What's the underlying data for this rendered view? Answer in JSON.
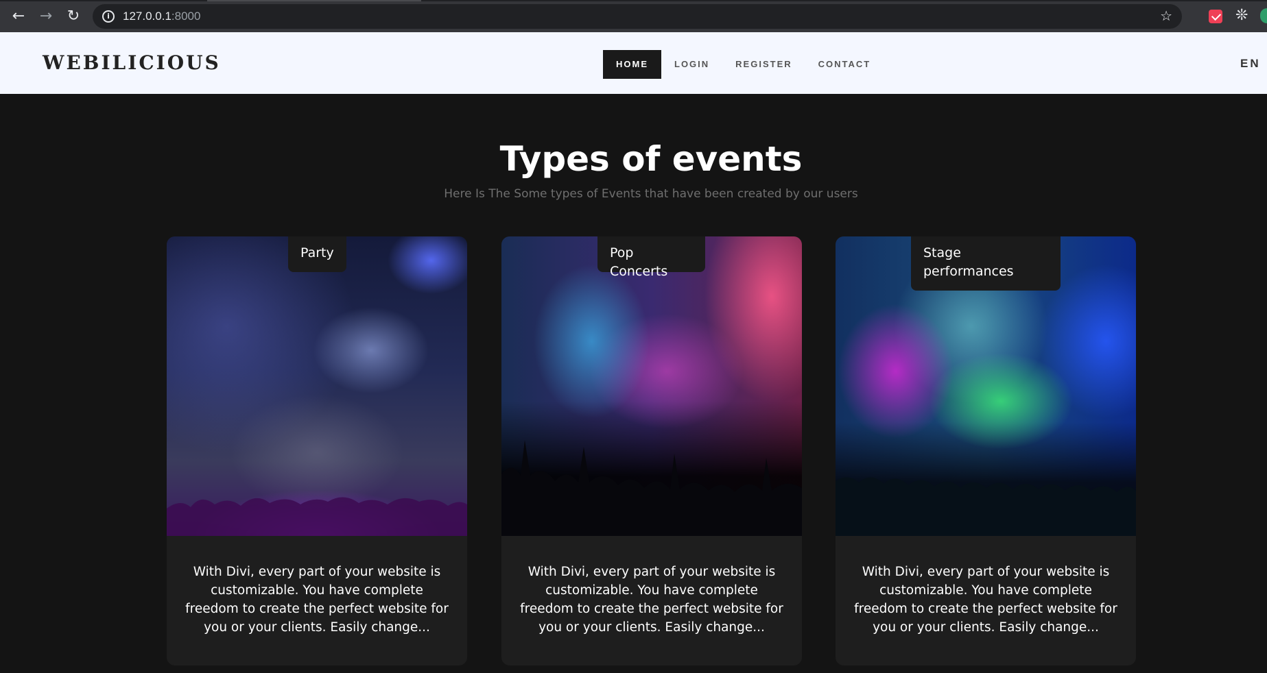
{
  "browser": {
    "url_host": "127.0.0.1",
    "url_port": ":8000",
    "icons": {
      "back": "arrow-left-icon",
      "forward": "arrow-right-icon",
      "reload": "reload-icon",
      "info": "info-icon",
      "bookmark": "star-icon",
      "extension_pocket": "pocket-icon",
      "extensions": "puzzle-icon"
    }
  },
  "header": {
    "logo": "WEBILICIOUS",
    "nav": [
      {
        "label": "HOME",
        "active": true
      },
      {
        "label": "LOGIN",
        "active": false
      },
      {
        "label": "REGISTER",
        "active": false
      },
      {
        "label": "CONTACT",
        "active": false
      }
    ],
    "language": "EN"
  },
  "section": {
    "title": "Types of events",
    "subtitle": "Here Is The Some types of Events that have been created by our users"
  },
  "cards": [
    {
      "label": "Party",
      "description": "With Divi, every part of your website is customizable. You have complete freedom to create the perfect website for you or your clients. Easily change..."
    },
    {
      "label": "Pop Concerts",
      "description": "With Divi, every part of your website is customizable. You have complete freedom to create the perfect website for you or your clients. Easily change..."
    },
    {
      "label": "Stage performances",
      "description": "With Divi, every part of your website is customizable. You have complete freedom to create the perfect website for you or your clients. Easily change..."
    }
  ],
  "colors": {
    "page_background": "#141414",
    "header_background": "#f4f7ff",
    "card_background": "#1e1e1e",
    "active_nav_background": "#1a1a1a"
  }
}
